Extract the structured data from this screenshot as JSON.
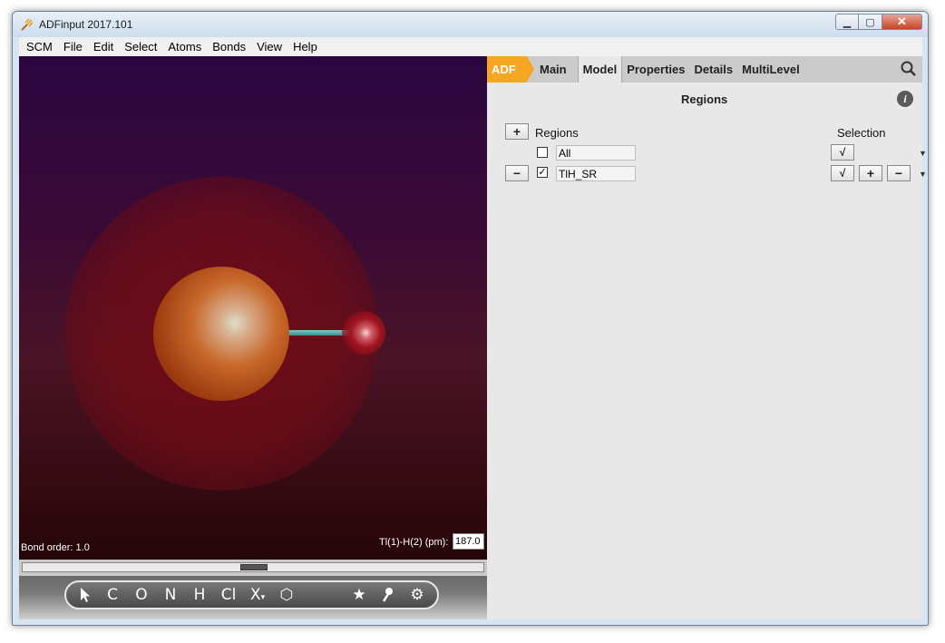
{
  "window": {
    "title": "ADFinput 2017.101"
  },
  "menu": [
    "SCM",
    "File",
    "Edit",
    "Select",
    "Atoms",
    "Bonds",
    "View",
    "Help"
  ],
  "viewport": {
    "bond_order": "Bond order: 1.0",
    "measure_label": "Tl(1)-H(2) (pm):",
    "measure_value": "187.0"
  },
  "toolbar": {
    "tools": [
      "C",
      "O",
      "N",
      "H",
      "Cl",
      "X",
      "hexagon",
      "star",
      "pin",
      "gear"
    ]
  },
  "panel": {
    "tabs": {
      "adf": "ADF",
      "items": [
        "Main",
        "Model",
        "Properties",
        "Details",
        "MultiLevel"
      ],
      "active": "Model"
    },
    "title": "Regions",
    "headers": {
      "regions": "Regions",
      "selection": "Selection"
    },
    "rows": [
      {
        "checked": false,
        "name": "All"
      },
      {
        "checked": true,
        "name": "TlH_SR"
      }
    ],
    "buttons": {
      "add": "+",
      "remove": "−",
      "check": "√",
      "plus": "+",
      "minus": "−"
    }
  }
}
